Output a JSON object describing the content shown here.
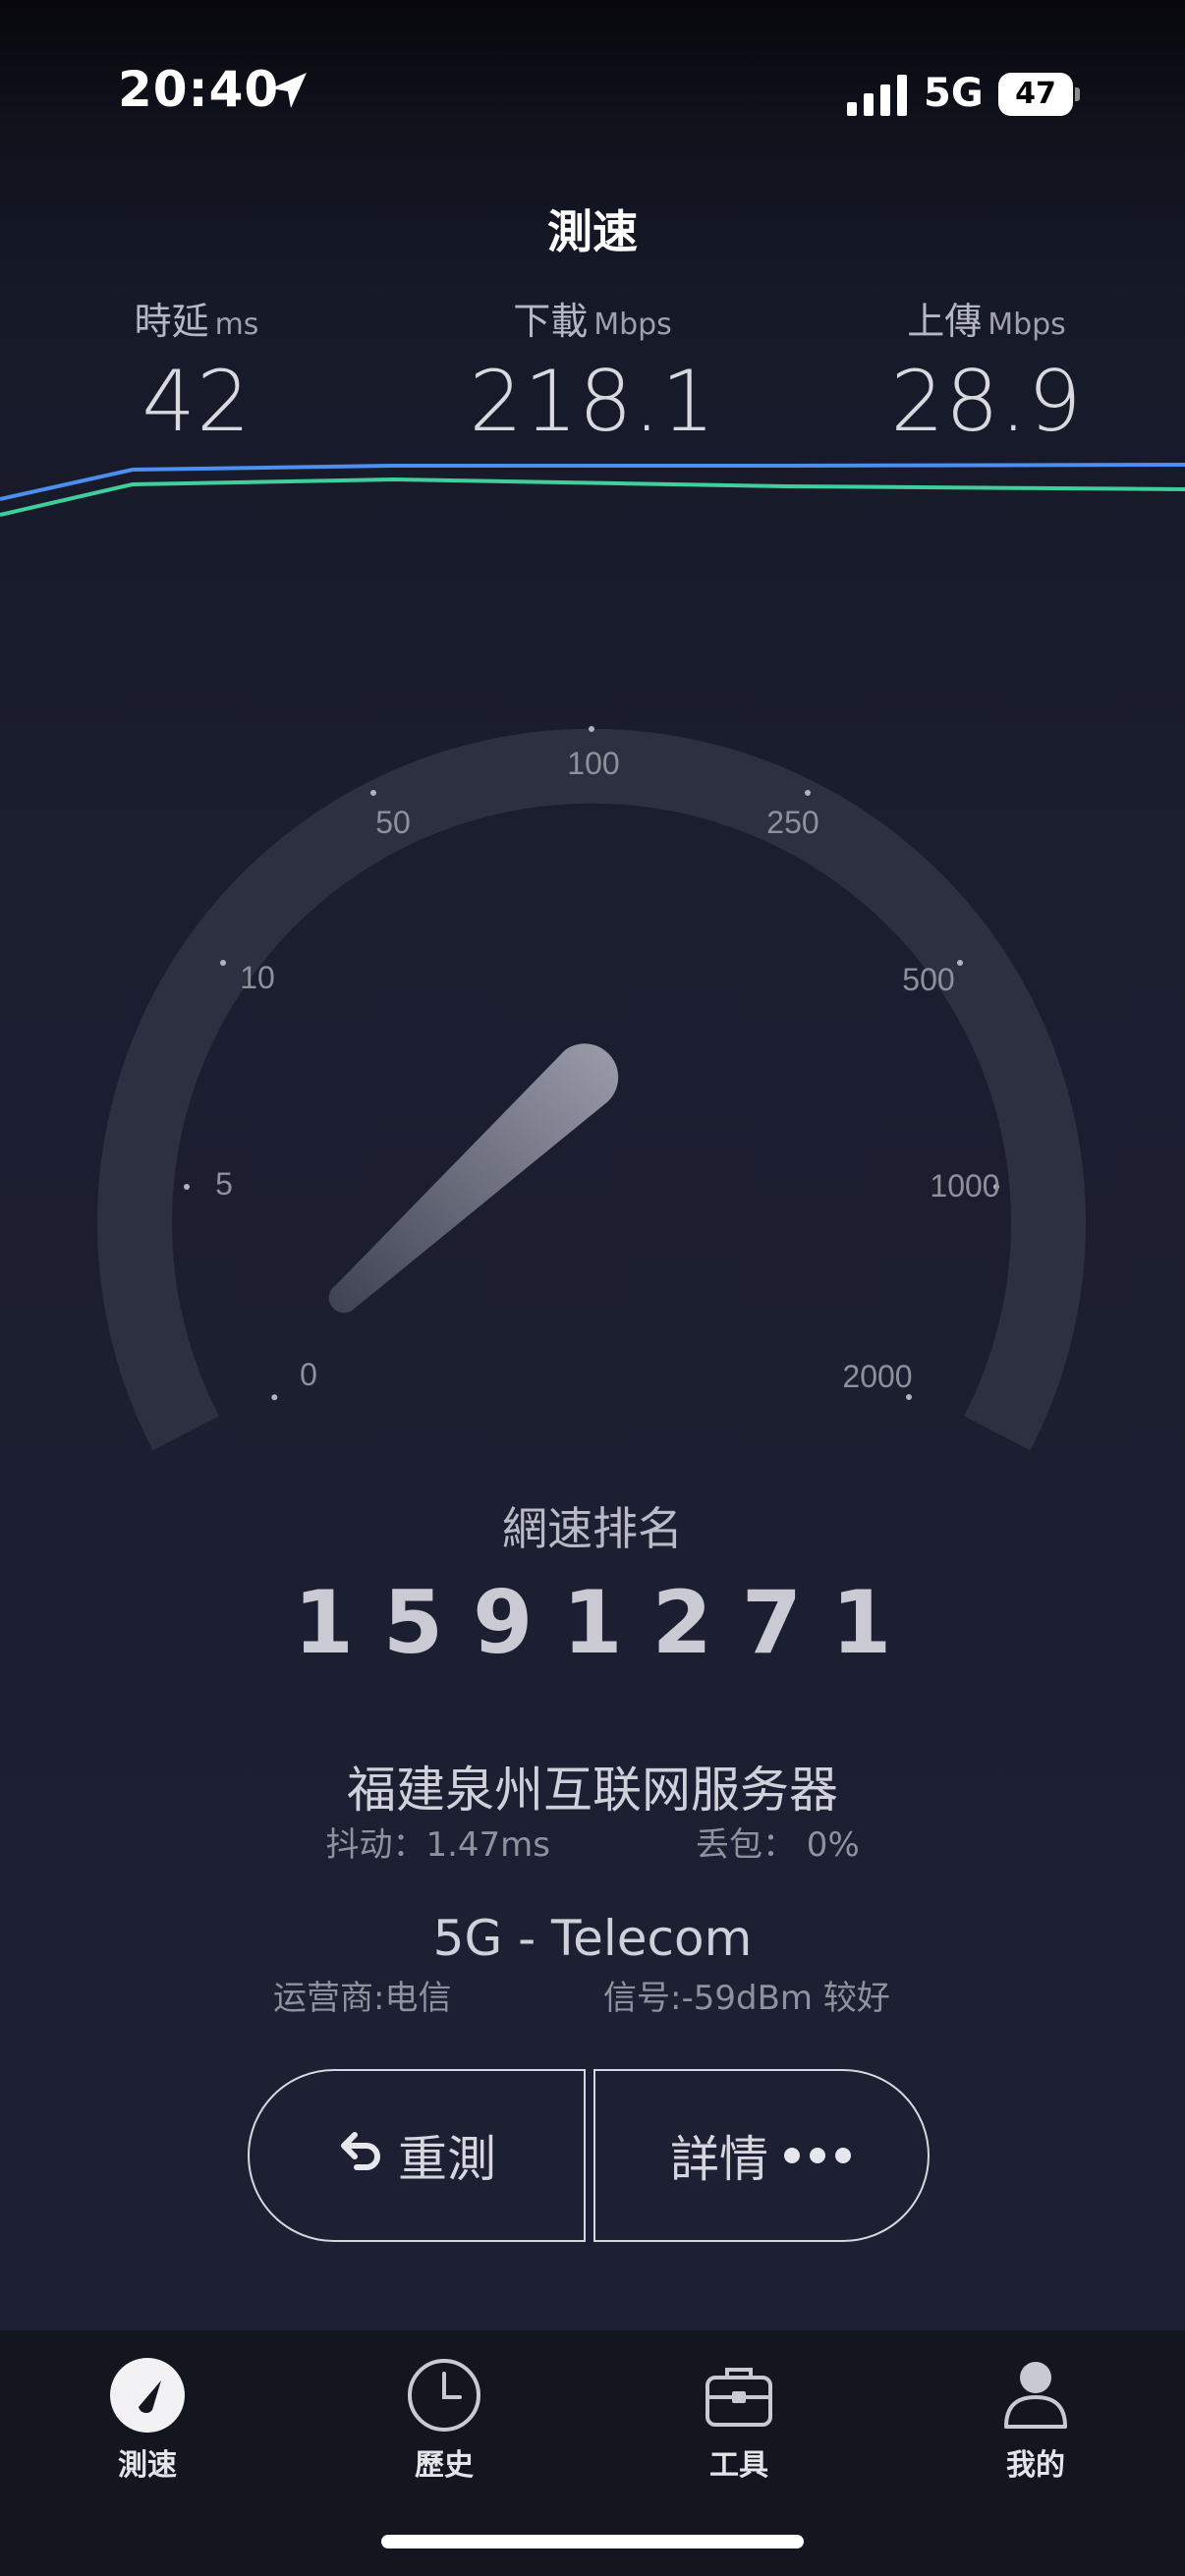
{
  "status_bar": {
    "time": "20:40",
    "network_type": "5G",
    "battery_level": "47",
    "icons": [
      "location-arrow-icon",
      "cellular-signal-icon",
      "battery-icon"
    ]
  },
  "header": {
    "title": "測速"
  },
  "metrics": {
    "latency": {
      "label": "時延",
      "unit": "ms",
      "value": "42"
    },
    "download": {
      "label": "下載",
      "unit": "Mbps",
      "value": "218.1"
    },
    "upload": {
      "label": "上傳",
      "unit": "Mbps",
      "value": "28.9"
    }
  },
  "graph_colors": {
    "download_line": "#4d8ff0",
    "upload_line": "#3fcf9a"
  },
  "gauge": {
    "tick_labels": [
      "0",
      "5",
      "10",
      "50",
      "100",
      "250",
      "500",
      "1000",
      "2000"
    ]
  },
  "ranking": {
    "label": "網速排名",
    "value": "1591271"
  },
  "server": {
    "name": "福建泉州互联网服务器",
    "jitter": "抖动：1.47ms",
    "packet_loss": "丢包： 0%"
  },
  "network": {
    "name": "5G - Telecom",
    "carrier": "运营商:电信",
    "signal": "信号:-59dBm 较好"
  },
  "actions": {
    "retest_label": "重測",
    "details_label": "詳情"
  },
  "tabs": [
    {
      "label": "測速",
      "icon": "speedometer-icon",
      "active": true
    },
    {
      "label": "歷史",
      "icon": "clock-icon",
      "active": false
    },
    {
      "label": "工具",
      "icon": "toolbox-icon",
      "active": false
    },
    {
      "label": "我的",
      "icon": "person-icon",
      "active": false
    }
  ]
}
